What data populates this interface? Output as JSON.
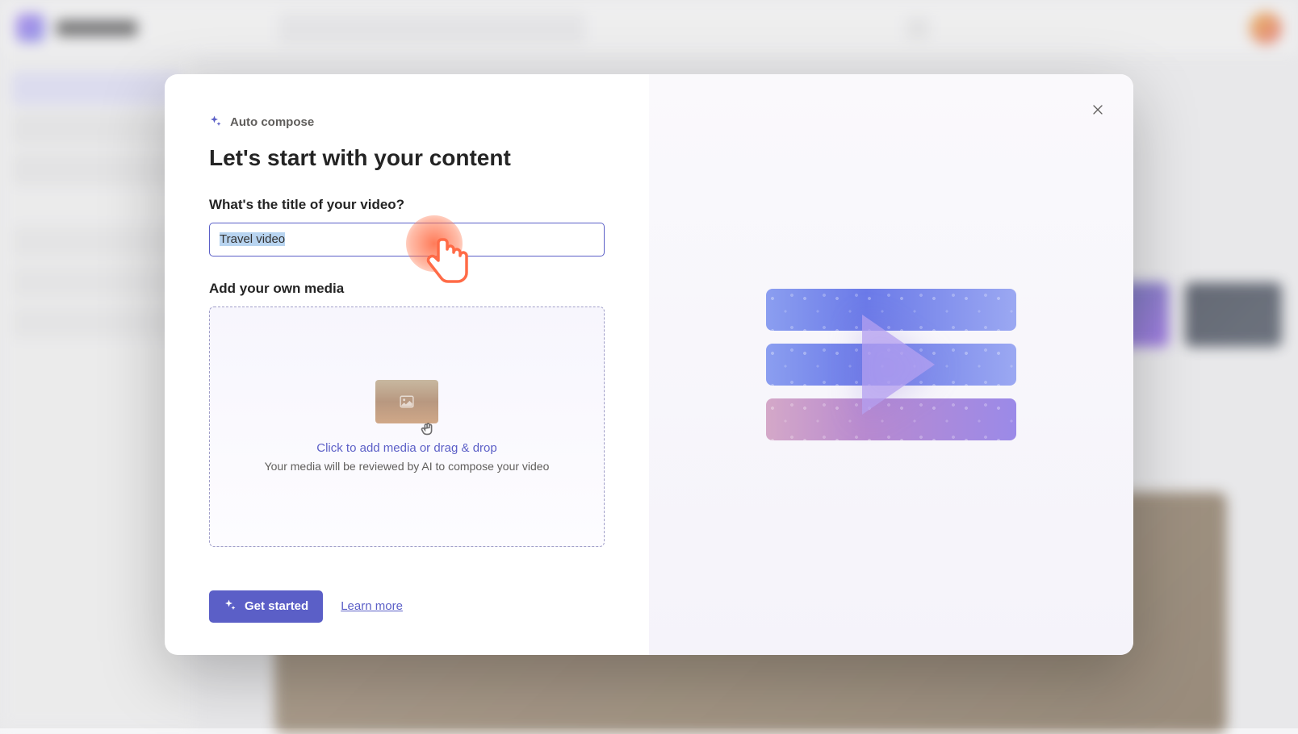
{
  "modal": {
    "featureLabel": "Auto compose",
    "title": "Let's start with your content",
    "titleFieldLabel": "What's the title of your video?",
    "titleInputValue": "Travel video",
    "mediaLabel": "Add your own media",
    "dropzone": {
      "primary": "Click to add media or drag & drop",
      "secondary": "Your media will be reviewed by AI to compose your video"
    },
    "getStartedLabel": "Get started",
    "learnMoreLabel": "Learn more"
  }
}
